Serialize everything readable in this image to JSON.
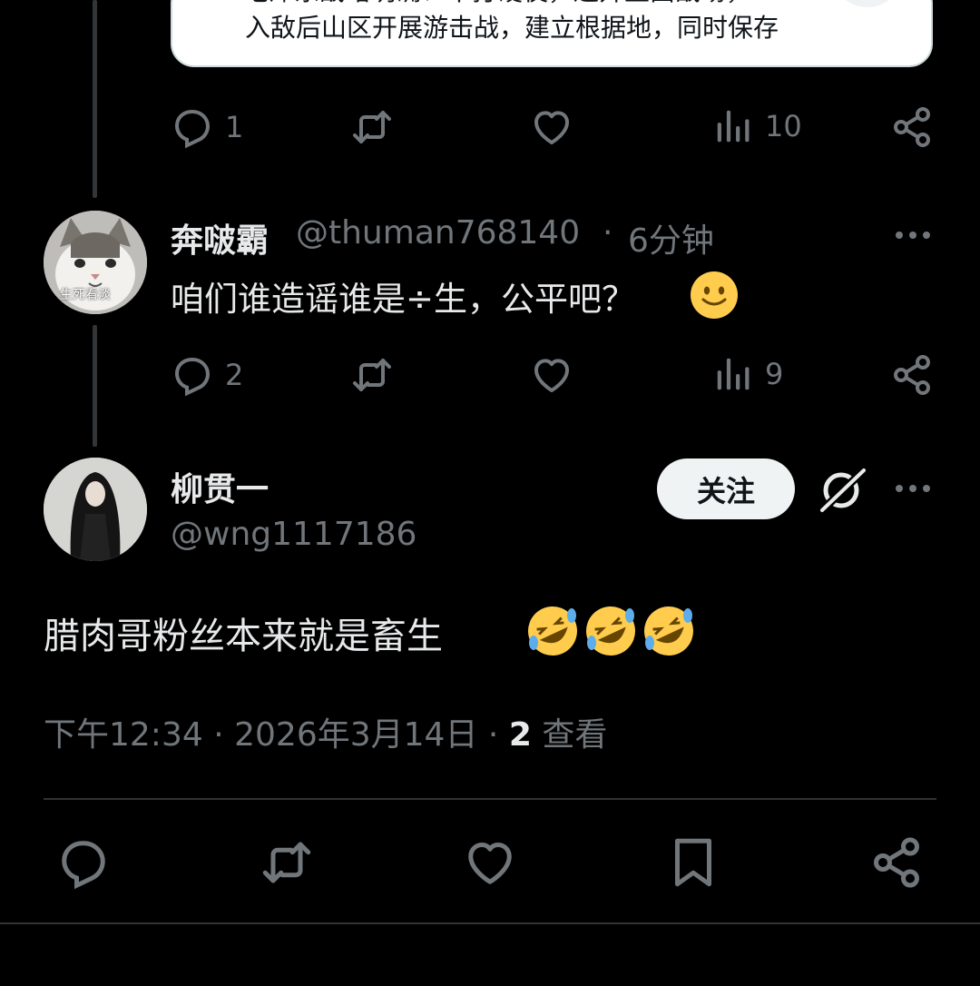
{
  "quoted_card": {
    "line1": "毛泽东战略明确：不打硬仗，避开正面战场，",
    "line2": "入敌后山区开展游击战，建立根据地，同时保存",
    "bullet": "•"
  },
  "post1_actions": {
    "replies": "1",
    "views": "10"
  },
  "reply": {
    "display_name": "奔啵霸",
    "handle": "@thuman768140",
    "separator": "·",
    "time": "6分钟",
    "text": "咱们谁造谣谁是÷生，公平吧？",
    "avatar_caption": "生死看淡",
    "actions": {
      "replies": "2",
      "views": "9"
    }
  },
  "main_post": {
    "display_name": "柳贯一",
    "handle": "@wng1117186",
    "follow_label": "关注",
    "text": "腊肉哥粉丝本来就是畜生",
    "time": "下午12:34",
    "sep1": "·",
    "date": "2026年3月14日",
    "sep2": "·",
    "view_count": "2",
    "view_label": "查看"
  },
  "colors": {
    "background": "#000000",
    "text": "#e7e9ea",
    "muted": "#71767b",
    "divider": "#2f3336",
    "emoji": "#ffcc4d"
  },
  "icons": [
    "reply-icon",
    "retweet-icon",
    "like-icon",
    "views-icon",
    "share-icon",
    "bookmark-icon",
    "more-icon",
    "grok-icon",
    "chevron-down-icon",
    "emoji-slightly-smiling",
    "emoji-rofl"
  ]
}
